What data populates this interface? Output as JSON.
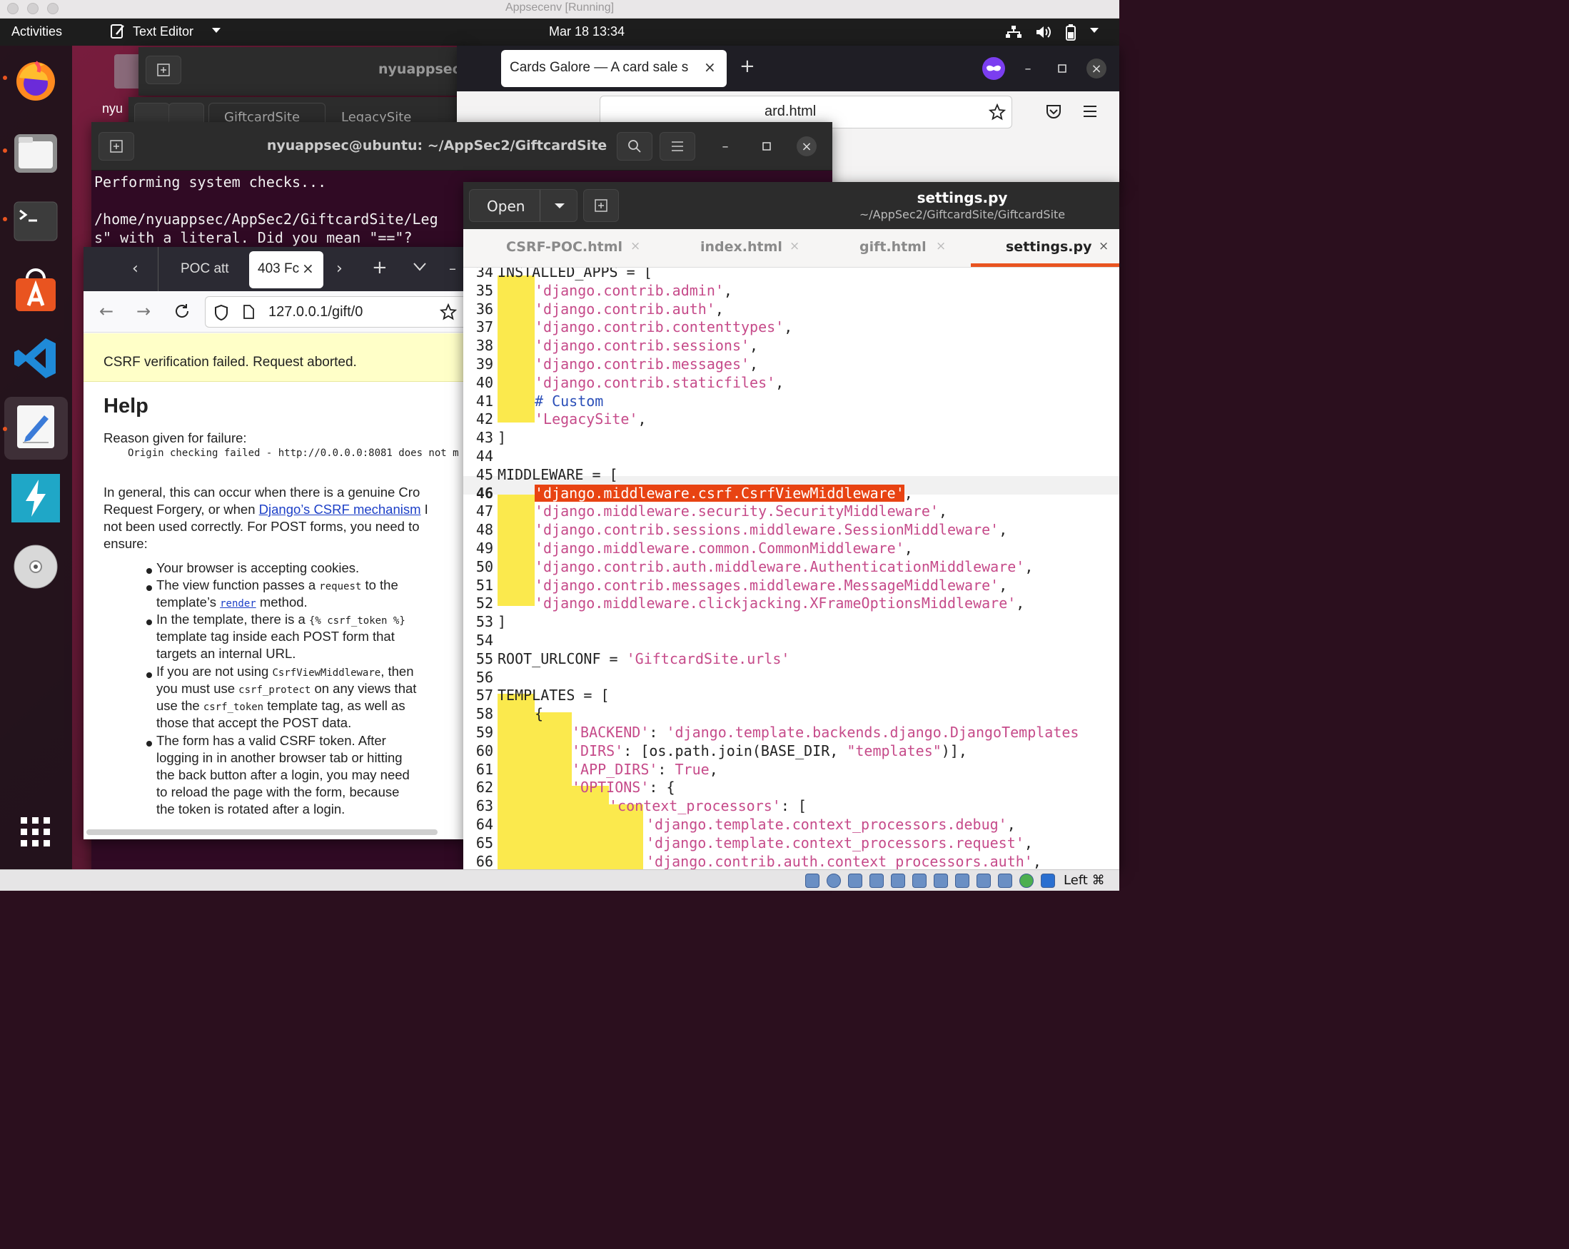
{
  "mac": {
    "title": "Appsecenv [Running]"
  },
  "topbar": {
    "activities": "Activities",
    "app": "Text Editor",
    "clock": "Mar 18  13:34"
  },
  "background_window": {
    "title": "nyuappsec(",
    "label": "nyu"
  },
  "firefox_right": {
    "tab_title": "Cards Galore — A card sale s",
    "url_fragment": "ard.html"
  },
  "files_window": {
    "tab1": "GiftcardSite",
    "tab2": "LegacySite"
  },
  "terminal": {
    "title": "nyuappsec@ubuntu: ~/AppSec2/GiftcardSite",
    "lines": [
      "Performing system checks...",
      "",
      "/home/nyuappsec/AppSec2/GiftcardSite/Leg",
      "s\" with a literal. Did you mean \"==\"?"
    ]
  },
  "firefox_left": {
    "tab1": "POC att",
    "tab2": "403 Fc",
    "url": "127.0.0.1/gift/0",
    "csrf_banner": "CSRF verification failed. Request aborted.",
    "help_title": "Help",
    "reason_label": "Reason given for failure:",
    "reason_text": "Origin checking failed - http://0.0.0.0:8081 does not m",
    "para1": [
      "In general, this can occur when there is a genuine Cro",
      "Request Forgery, or when ",
      "Django’s CSRF mechanism",
      "not been used correctly. For POST forms, you need to",
      "ensure:"
    ],
    "b1": "Your browser is accepting cookies.",
    "b2a": "The view function passes a ",
    "b2code": "request",
    "b2b": " to the",
    "b2c": "template’s ",
    "b2link": "render",
    "b2d": " method.",
    "b3a": "In the template, there is a ",
    "b3code": "{% csrf_token %}",
    "b3b": "template tag inside each POST form that",
    "b3c": "targets an internal URL.",
    "b4a": "If you are not using ",
    "b4code": "CsrfViewMiddleware",
    "b4b": ", then",
    "b4c": "you must use ",
    "b4code2": "csrf_protect",
    "b4d": " on any views that",
    "b4e": "use the ",
    "b4code3": "csrf_token",
    "b4f": " template tag, as well as",
    "b4g": "those that accept the POST data.",
    "b5a": "The form has a valid CSRF token. After",
    "b5b": "logging in in another browser tab or hitting",
    "b5c": "the back button after a login, you may need",
    "b5d": "to reload the page with the form, because",
    "b5e": "the token is rotated after a login."
  },
  "gedit": {
    "open_label": "Open",
    "filename": "settings.py",
    "path": "~/AppSec2/GiftcardSite/GiftcardSite",
    "tabs": [
      "CSRF-POC.html",
      "index.html",
      "gift.html",
      "settings.py"
    ],
    "active_tab": "settings.py",
    "code": [
      {
        "n": "34",
        "t": "INSTALLED_APPS = ["
      },
      {
        "n": "35",
        "t": "'django.contrib.admin',"
      },
      {
        "n": "36",
        "t": "'django.contrib.auth',"
      },
      {
        "n": "37",
        "t": "'django.contrib.contenttypes',"
      },
      {
        "n": "38",
        "t": "'django.contrib.sessions',"
      },
      {
        "n": "39",
        "t": "'django.contrib.messages',"
      },
      {
        "n": "40",
        "t": "'django.contrib.staticfiles',"
      },
      {
        "n": "41",
        "t": "# Custom"
      },
      {
        "n": "42",
        "t": "'LegacySite',"
      },
      {
        "n": "43",
        "t": "]"
      },
      {
        "n": "44",
        "t": ""
      },
      {
        "n": "45",
        "t": "MIDDLEWARE = ["
      },
      {
        "n": "46",
        "t": "'django.middleware.csrf.CsrfViewMiddleware',"
      },
      {
        "n": "47",
        "t": "'django.middleware.security.SecurityMiddleware',"
      },
      {
        "n": "48",
        "t": "'django.contrib.sessions.middleware.SessionMiddleware',"
      },
      {
        "n": "49",
        "t": "'django.middleware.common.CommonMiddleware',"
      },
      {
        "n": "50",
        "t": "'django.contrib.auth.middleware.AuthenticationMiddleware',"
      },
      {
        "n": "51",
        "t": "'django.contrib.messages.middleware.MessageMiddleware',"
      },
      {
        "n": "52",
        "t": "'django.middleware.clickjacking.XFrameOptionsMiddleware',"
      },
      {
        "n": "53",
        "t": "]"
      },
      {
        "n": "54",
        "t": ""
      },
      {
        "n": "55",
        "t": "ROOT_URLCONF = 'GiftcardSite.urls'"
      },
      {
        "n": "56",
        "t": ""
      },
      {
        "n": "57",
        "t": "TEMPLATES = ["
      },
      {
        "n": "58",
        "t": "{"
      },
      {
        "n": "59",
        "t": "'BACKEND': 'django.template.backends.django.DjangoTemplates"
      },
      {
        "n": "60",
        "t": "'DIRS': [os.path.join(BASE_DIR, \"templates\")],"
      },
      {
        "n": "61",
        "t": "'APP_DIRS': True,"
      },
      {
        "n": "62",
        "t": "'OPTIONS': {"
      },
      {
        "n": "63",
        "t": "'context_processors': ["
      },
      {
        "n": "64",
        "t": "'django.template.context_processors.debug',"
      },
      {
        "n": "65",
        "t": "'django.template.context_processors.request',"
      },
      {
        "n": "66",
        "t": "'django.contrib.auth.context_processors.auth',"
      }
    ]
  },
  "vbox": {
    "host_key": "Left ⌘"
  },
  "colors": {
    "ubuntu_orange": "#e95420",
    "highlight_yellow": "#fbe94d",
    "selection": "#e84312",
    "string_pink": "#c64b8a"
  }
}
